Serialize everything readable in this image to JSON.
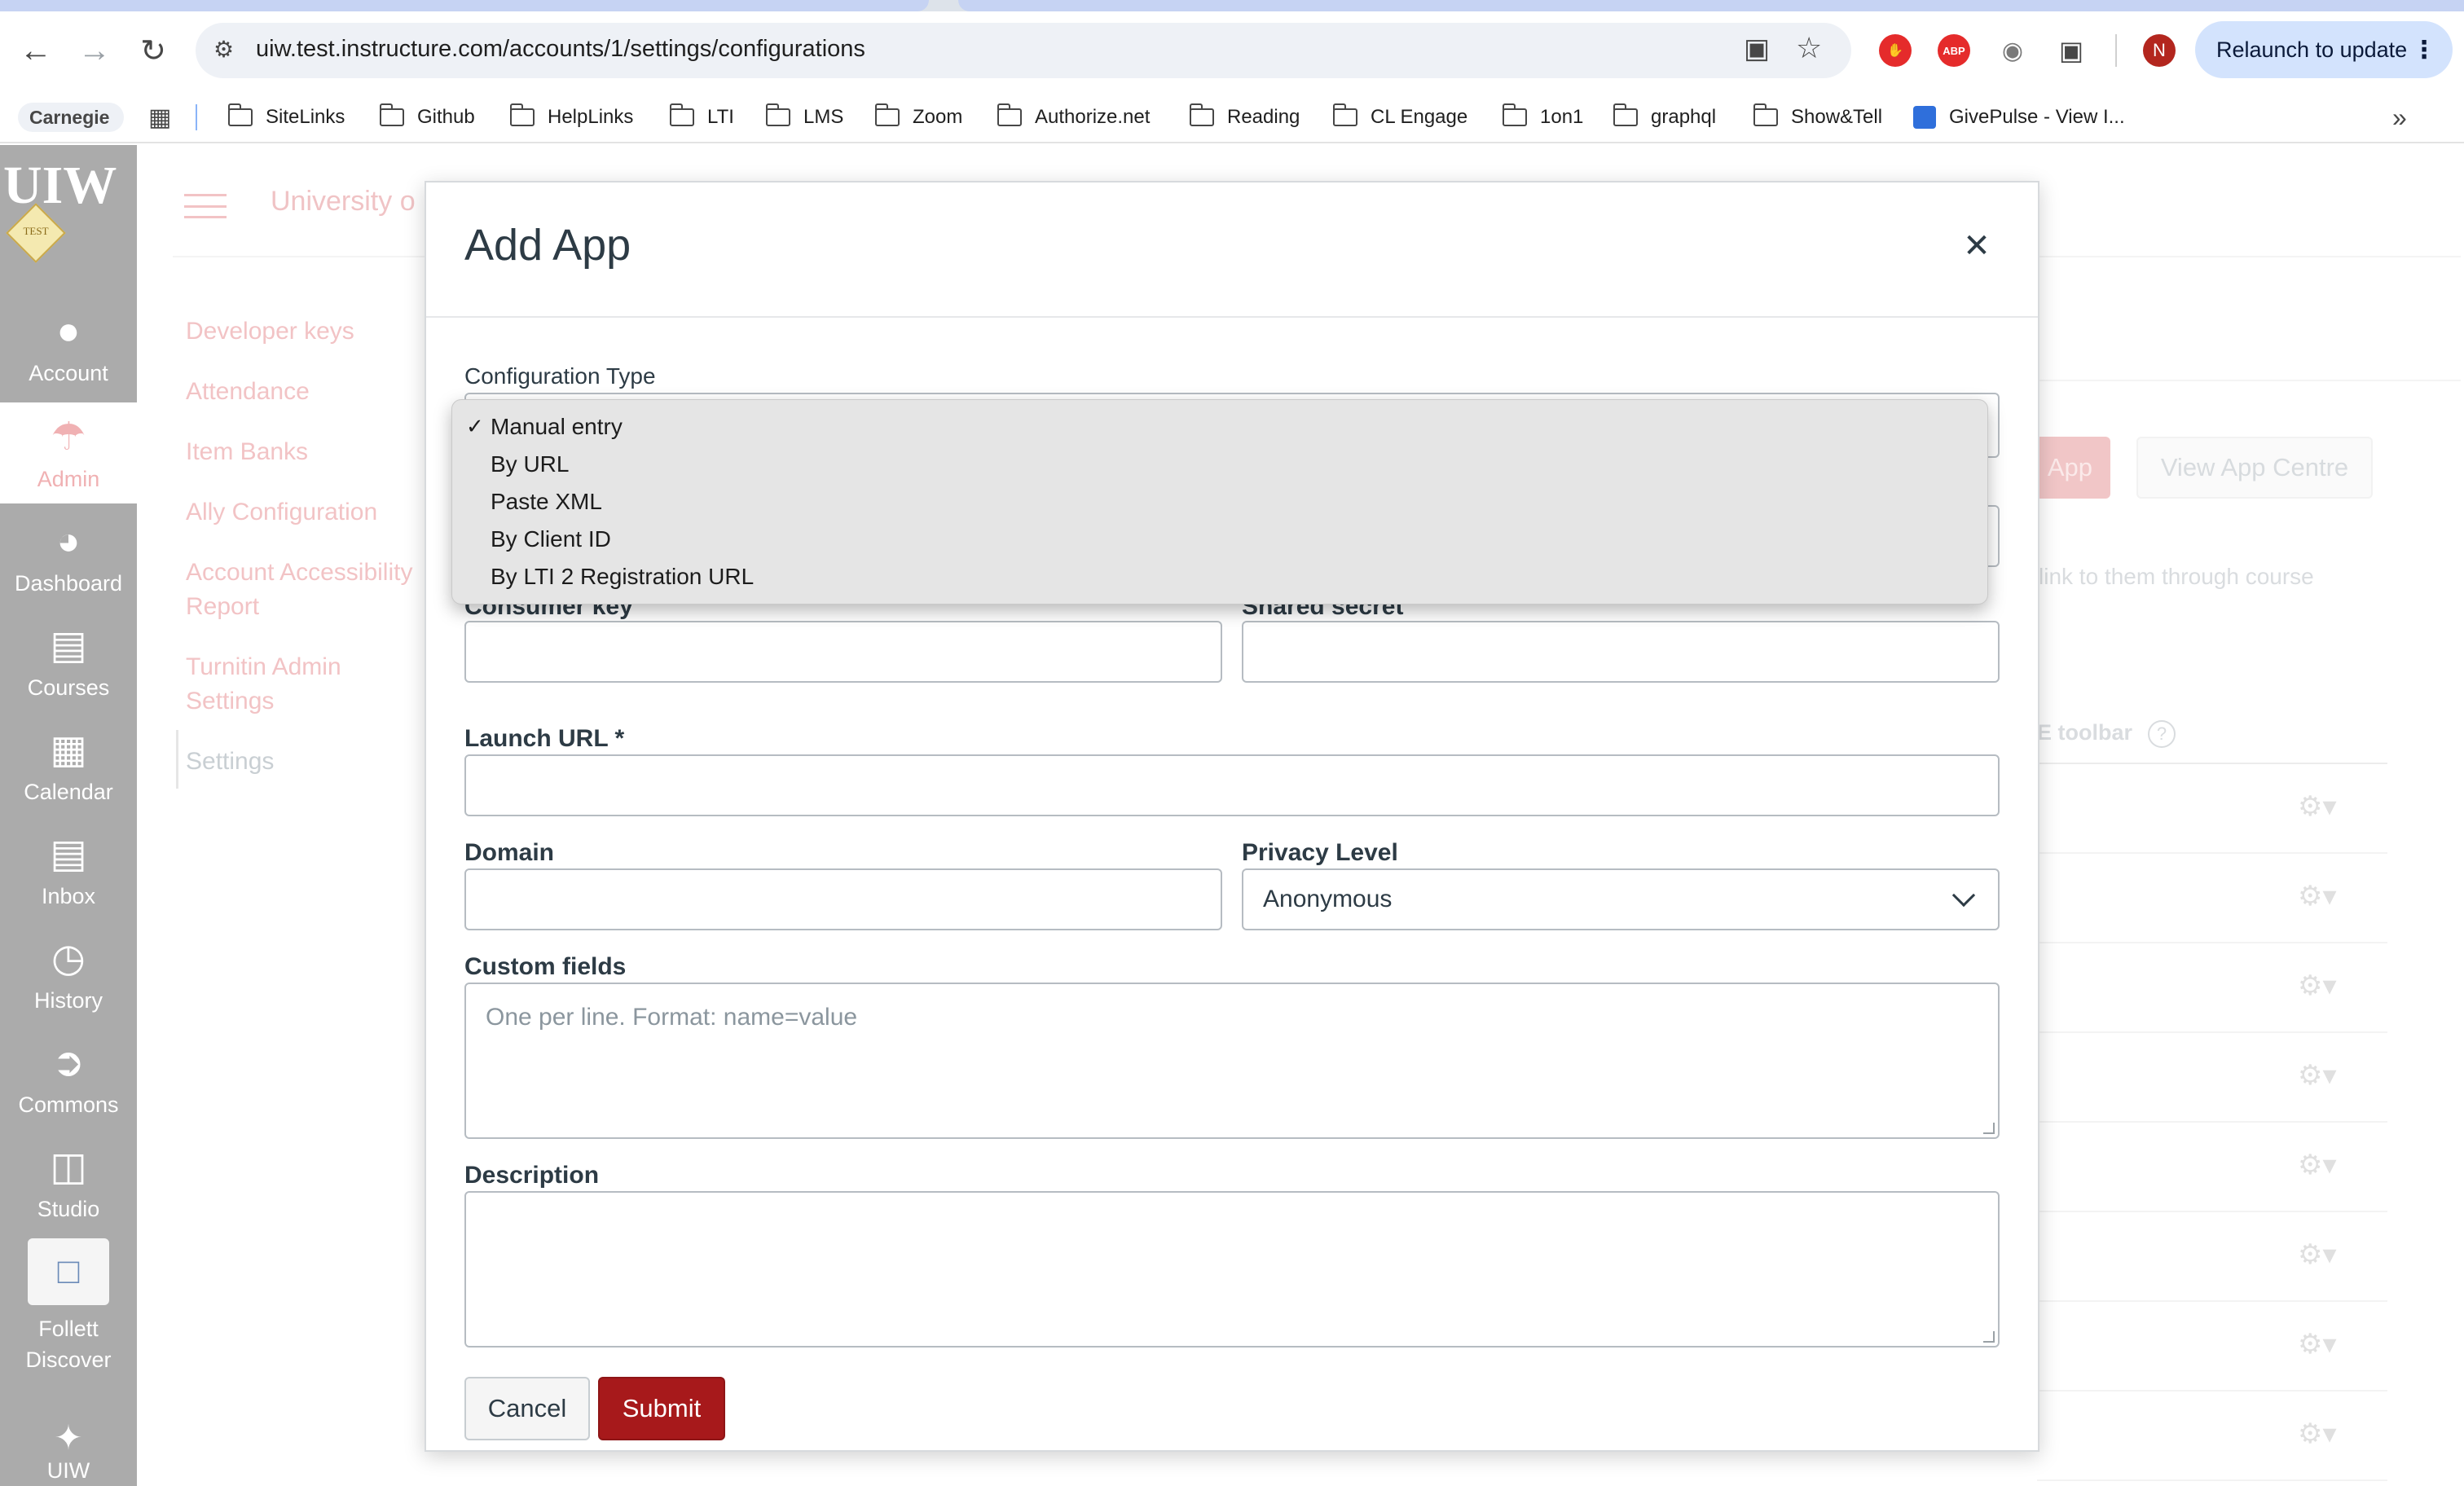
{
  "browser": {
    "url": "uiw.test.instructure.com/accounts/1/settings/configurations",
    "relaunch_label": "Relaunch to update",
    "profile_initial": "N",
    "bookmarks": [
      "Carnegie",
      "SiteLinks",
      "Github",
      "HelpLinks",
      "LTI",
      "LMS",
      "Zoom",
      "Authorize.net",
      "Reading",
      "CL Engage",
      "1on1",
      "graphql",
      "Show&Tell",
      "GivePulse - View I..."
    ]
  },
  "global_nav": {
    "logo_text": "UIW",
    "logo_badge": "TEST",
    "items": [
      "Account",
      "Admin",
      "Dashboard",
      "Courses",
      "Calendar",
      "Inbox",
      "History",
      "Commons",
      "Studio",
      "Follett Discover",
      "UIW"
    ]
  },
  "background": {
    "account_title": "University o",
    "subnav": [
      "Developer keys",
      "Attendance",
      "Item Banks",
      "Ally Configuration",
      "Account Accessibility",
      "Report",
      "Turnitin Admin",
      "Settings",
      "Settings"
    ],
    "add_app_fragment": "App",
    "view_app_centre": "View App Centre",
    "link_text": "link to them through course",
    "toolbar_text": "E toolbar"
  },
  "modal": {
    "title": "Add App",
    "config_type_label": "Configuration Type",
    "consumer_key_label": "Consumer key",
    "shared_secret_label": "Shared secret",
    "launch_url_label": "Launch URL *",
    "domain_label": "Domain",
    "privacy_label": "Privacy Level",
    "privacy_value": "Anonymous",
    "custom_fields_label": "Custom fields",
    "custom_fields_placeholder": "One per line. Format: name=value",
    "description_label": "Description",
    "cancel_label": "Cancel",
    "submit_label": "Submit"
  },
  "dropdown": {
    "selected_mark": "✓",
    "options": [
      "Manual entry",
      "By URL",
      "Paste XML",
      "By Client ID",
      "By LTI 2 Registration URL"
    ]
  },
  "colors": {
    "submit": "#a7191b",
    "nav_bg": "#ababab",
    "relaunch_bg": "#d3e3fd"
  }
}
